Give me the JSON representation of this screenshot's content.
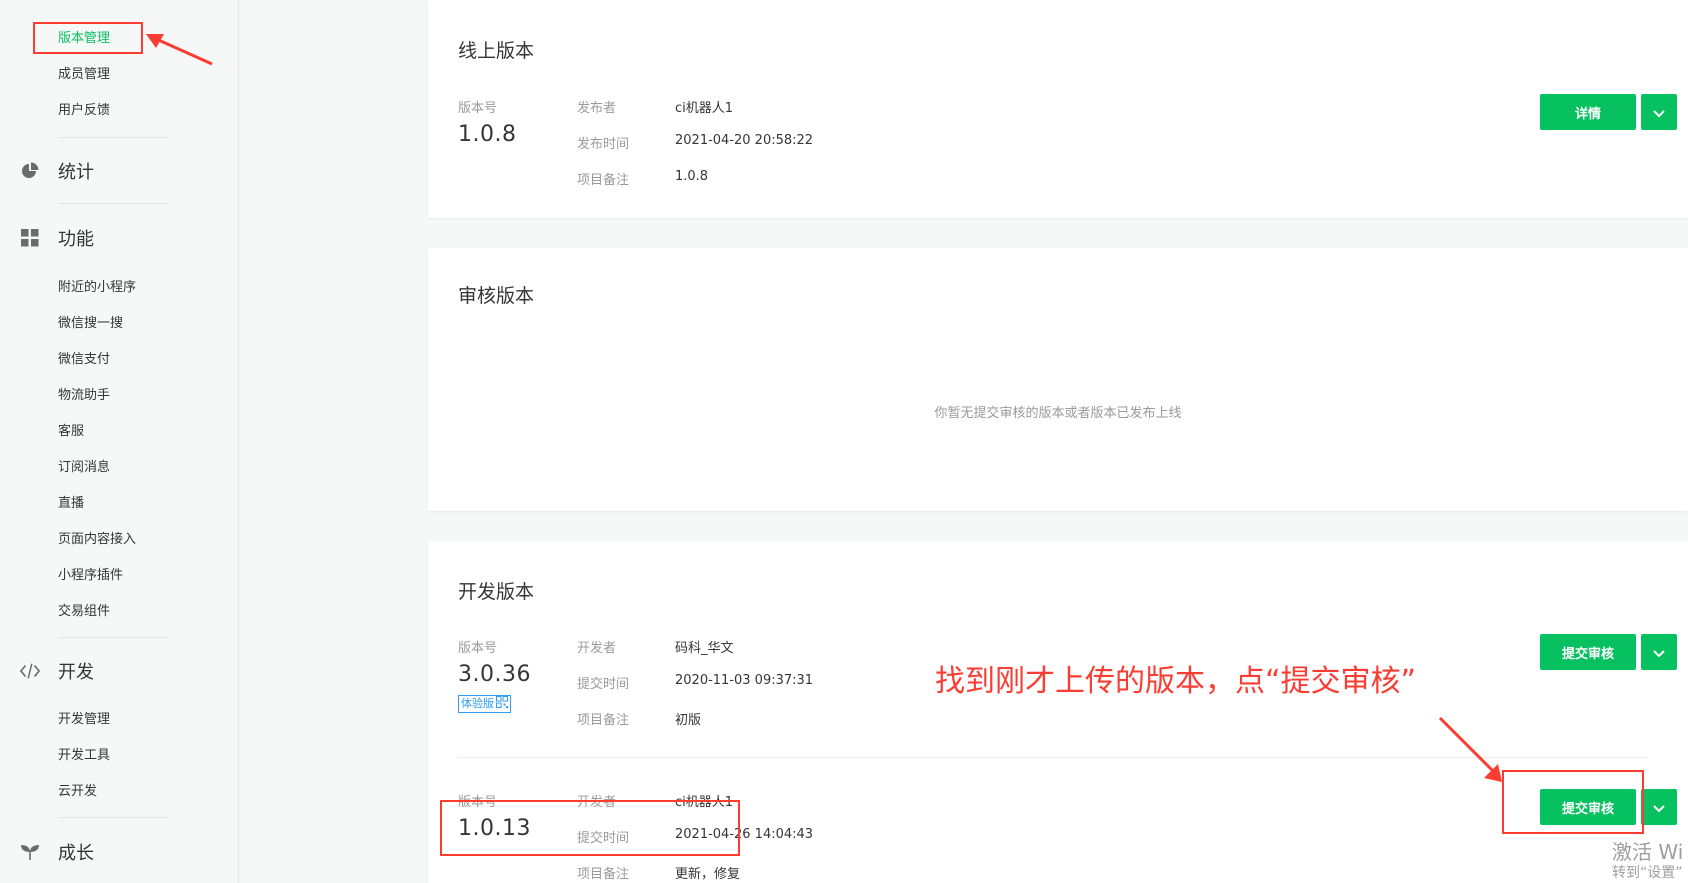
{
  "sidebar": {
    "top_items": [
      "版本管理",
      "成员管理",
      "用户反馈"
    ],
    "sections": [
      {
        "label": "统计",
        "icon": "pie-chart-icon"
      },
      {
        "label": "功能",
        "icon": "grid-icon"
      },
      {
        "label": "开发",
        "icon": "code-icon"
      },
      {
        "label": "成长",
        "icon": "sprout-icon"
      }
    ],
    "feature_items": [
      "附近的小程序",
      "微信搜一搜",
      "微信支付",
      "物流助手",
      "客服",
      "订阅消息",
      "直播",
      "页面内容接入",
      "小程序插件",
      "交易组件"
    ],
    "dev_items": [
      "开发管理",
      "开发工具",
      "云开发"
    ]
  },
  "online": {
    "title": "线上版本",
    "version_label": "版本号",
    "version": "1.0.8",
    "fields": [
      {
        "label": "发布者",
        "value": "ci机器人1"
      },
      {
        "label": "发布时间",
        "value": "2021-04-20 20:58:22"
      },
      {
        "label": "项目备注",
        "value": "1.0.8"
      }
    ],
    "button": "详情"
  },
  "review": {
    "title": "审核版本",
    "empty": "你暂无提交审核的版本或者版本已发布上线"
  },
  "dev": {
    "title": "开发版本",
    "items": [
      {
        "version_label": "版本号",
        "version": "3.0.36",
        "badge": "体验版",
        "fields": [
          {
            "label": "开发者",
            "value": "码科_华文"
          },
          {
            "label": "提交时间",
            "value": "2020-11-03 09:37:31"
          },
          {
            "label": "项目备注",
            "value": "初版"
          }
        ],
        "button": "提交审核"
      },
      {
        "version_label": "版本号",
        "version": "1.0.13",
        "fields": [
          {
            "label": "开发者",
            "value": "ci机器人1"
          },
          {
            "label": "提交时间",
            "value": "2021-04-26 14:04:43"
          },
          {
            "label": "项目备注",
            "value": "更新，修复"
          }
        ],
        "button": "提交审核"
      }
    ]
  },
  "annotation": {
    "text": "找到刚才上传的版本，点“提交审核”",
    "color": "#fa3c32"
  },
  "watermark": {
    "line1": "激活 Wi",
    "line2": "转到“设置”"
  },
  "colors": {
    "accent": "#07c160",
    "annotation_red": "#fa3c32",
    "badge_blue": "#2f9cf3"
  }
}
